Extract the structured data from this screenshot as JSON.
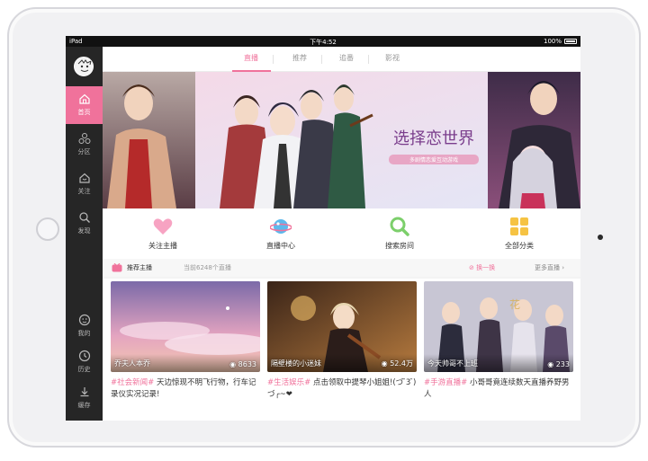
{
  "status": {
    "carrier": "iPad",
    "time": "下午4:52",
    "battery": "100%"
  },
  "sidebar": {
    "items": [
      {
        "label": "首页",
        "icon": "home-icon"
      },
      {
        "label": "分区",
        "icon": "category-icon"
      },
      {
        "label": "关注",
        "icon": "follow-icon"
      },
      {
        "label": "发现",
        "icon": "discover-icon"
      },
      {
        "label": "我的",
        "icon": "profile-icon"
      },
      {
        "label": "历史",
        "icon": "history-icon"
      },
      {
        "label": "缓存",
        "icon": "download-icon"
      }
    ]
  },
  "tabs": [
    "直播",
    "推荐",
    "追番",
    "影视"
  ],
  "banner": {
    "title": "选择恋世界",
    "subtitle": "多剧情恋爱互动游戏"
  },
  "categories": [
    {
      "label": "关注主播",
      "icon": "heart-icon"
    },
    {
      "label": "直播中心",
      "icon": "planet-icon"
    },
    {
      "label": "搜索房间",
      "icon": "search-icon"
    },
    {
      "label": "全部分类",
      "icon": "grid-icon"
    }
  ],
  "recommend": {
    "title": "推荐主播",
    "count": "当前6248个直播",
    "refresh": "换一换",
    "more": "更多直播"
  },
  "cards": [
    {
      "name": "乔夫人本乔",
      "views": "8633",
      "tag": "#社会新闻#",
      "desc": " 天边惊现不明飞行物，行车记录仪实况记录!"
    },
    {
      "name": "隔壁楼的小迷妹",
      "views": "52.4万",
      "tag": "#生活娱乐#",
      "desc": " 点击领取中提琴小姐姐!(づ ̄3 ̄)づ╭~❤"
    },
    {
      "name": "今天帅哥不上班",
      "views": "233",
      "tag": "#手游直播#",
      "desc": " 小哥哥竟连续数天直播养野男人"
    }
  ],
  "colors": {
    "accent": "#f0729b",
    "sidebar": "#262626"
  }
}
